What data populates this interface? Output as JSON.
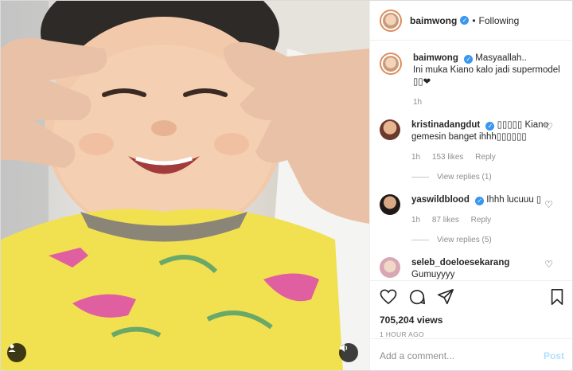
{
  "header": {
    "username": "baimwong",
    "separator": "•",
    "follow_status": "Following"
  },
  "caption": {
    "username": "baimwong",
    "text": "Masyaallah..",
    "text2": "Ini muka Kiano kalo jadi supermodel",
    "emoji": "▯▯❤",
    "time": "1h"
  },
  "comments": [
    {
      "username": "kristinadangdut",
      "text": "▯▯▯▯▯ Kiano gemesin banget ihhh▯▯▯▯▯▯",
      "time": "1h",
      "likes": "153 likes",
      "reply": "Reply",
      "view_replies": "View replies (1)"
    },
    {
      "username": "yaswildblood",
      "text": "Ihhh lucuuu ▯",
      "time": "1h",
      "likes": "87 likes",
      "reply": "Reply",
      "view_replies": "View replies (5)"
    },
    {
      "username": "seleb_doeloesekarang",
      "text": "Gumuyyyy"
    }
  ],
  "stats": {
    "views": "705,204 views",
    "ago": "1 HOUR AGO"
  },
  "composer": {
    "placeholder": "Add a comment...",
    "post_label": "Post"
  },
  "colors": {
    "verified": "#3897f0",
    "post_disabled": "#b2dffc",
    "avatar_ring": "#e08d5b"
  },
  "icons": [
    "user-tag-icon",
    "sound-icon",
    "heart-icon",
    "comment-icon",
    "share-icon",
    "bookmark-icon"
  ]
}
